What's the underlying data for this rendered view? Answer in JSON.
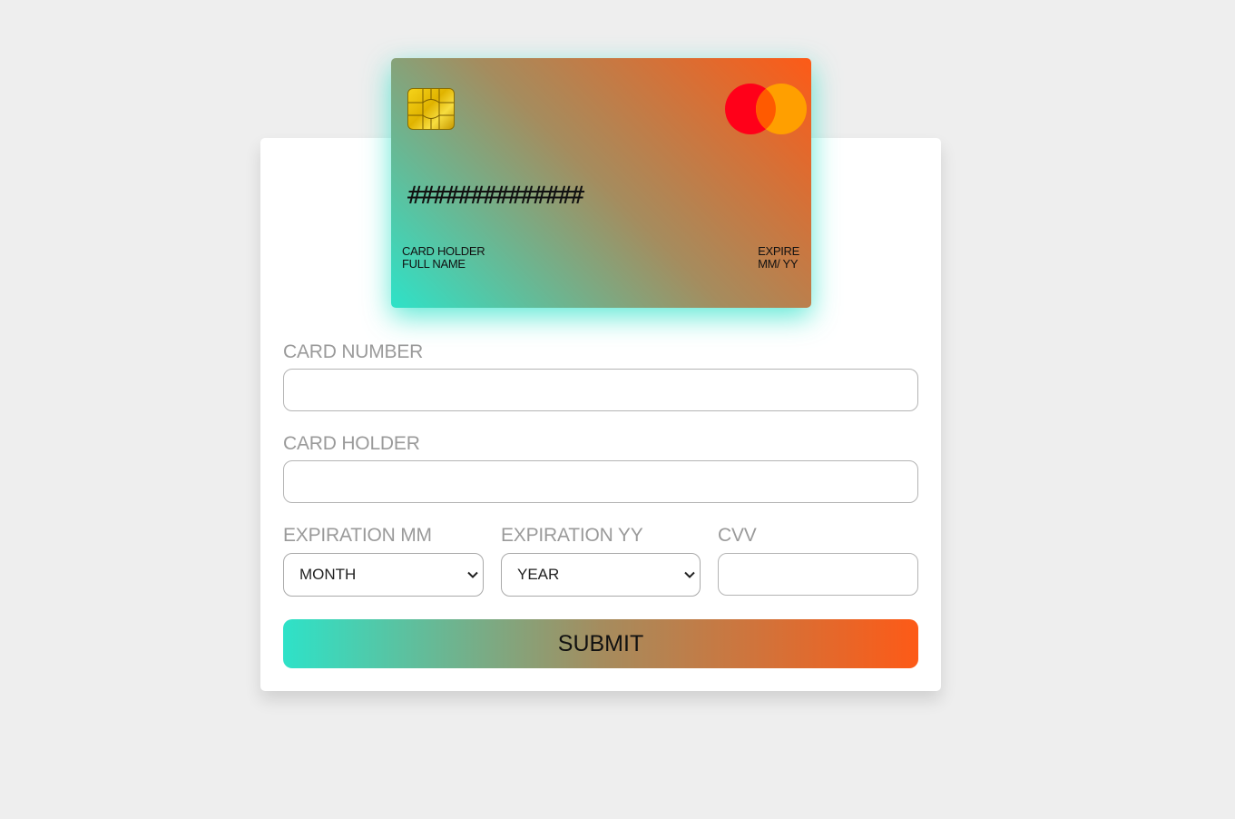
{
  "card": {
    "number": "##############",
    "holder_label": "CARD HOLDER",
    "holder_value": "FULL NAME",
    "expire_label": "EXPIRE",
    "expire_value": "MM/ YY",
    "chip_icon": "sim-chip-icon",
    "brand_logo": "mastercard-logo",
    "gradient": [
      "#2ee2c8",
      "#fd5a17"
    ]
  },
  "form": {
    "card_number_label": "CARD NUMBER",
    "card_number_value": "",
    "card_holder_label": "CARD HOLDER",
    "card_holder_value": "",
    "exp_month_label": "EXPIRATION MM",
    "exp_month_value": "MONTH",
    "exp_year_label": "EXPIRATION YY",
    "exp_year_value": "YEAR",
    "cvv_label": "CVV",
    "cvv_value": "",
    "submit_label": "SUBMIT"
  },
  "colors": {
    "background": "#eeeeee",
    "panel": "#ffffff",
    "label": "#9a9a9a",
    "mastercard_red": "#ff0019",
    "mastercard_orange": "#ff9f00"
  }
}
